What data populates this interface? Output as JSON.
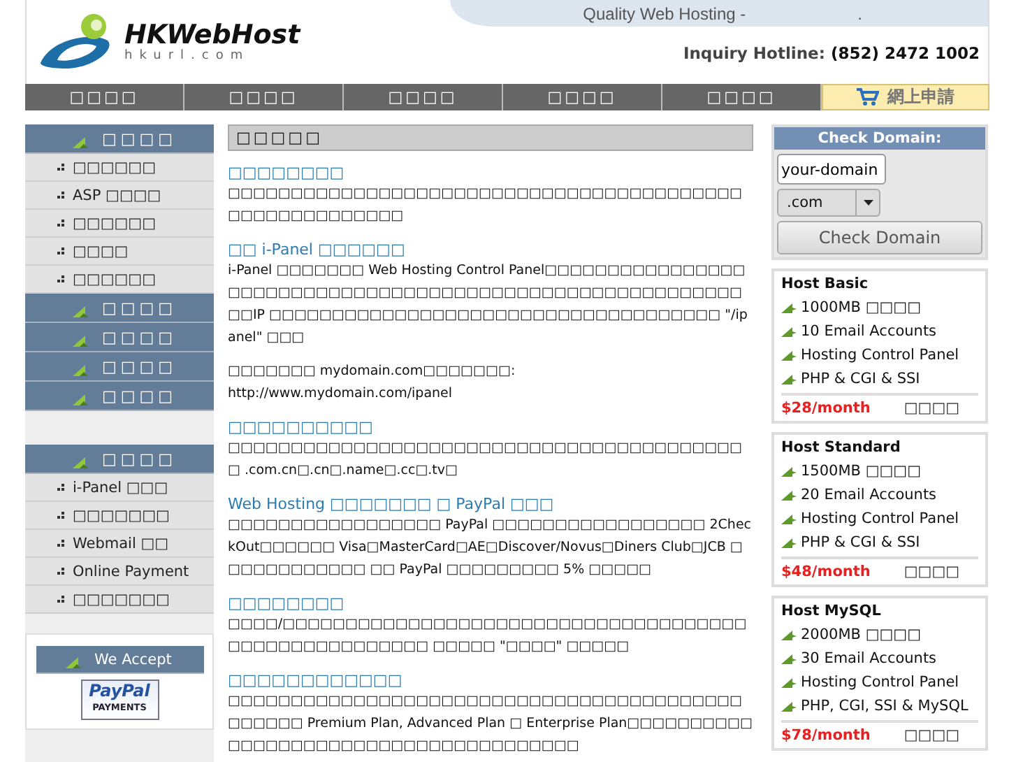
{
  "header": {
    "logo_name": "HKWebHost",
    "logo_url": "hkurl.com",
    "tagline": "Quality Web Hosting -",
    "tagline_suffix": ".",
    "hotline_label": "Inquiry Hotline:",
    "hotline_number": "(852) 2472 1002"
  },
  "nav": {
    "items": [
      "□□□□",
      "□□□□",
      "□□□□",
      "□□□□",
      "□□□□"
    ],
    "order_button": "網上申請"
  },
  "sidebar": {
    "menu": [
      {
        "title": "□□□□",
        "children": [
          "□□□□□□",
          "ASP □□□□",
          "□□□□□□",
          "□□□□",
          "□□□□□□"
        ]
      },
      {
        "title": "□□□□"
      },
      {
        "title": "□□□□"
      },
      {
        "title": "□□□□"
      },
      {
        "title": "□□□□"
      }
    ],
    "support": {
      "title": "□□□□",
      "children": [
        "i-Panel □□□",
        "□□□□□□□",
        "Webmail □□",
        "Online Payment",
        "□□□□□□□"
      ]
    },
    "accept": {
      "title": "We Accept",
      "logo_top": "PayPal",
      "logo_bottom": "PAYMENTS"
    }
  },
  "content": {
    "title": "□□□□□",
    "sections": [
      {
        "heading": "□□□□□□□□",
        "paragraphs": [
          "□□□□□□□□□□□□□□□□□□□□□□□□□□□□□□□□□□□□□□□□□□□□□□□□□□□□□□□"
        ]
      },
      {
        "heading": "□□ i-Panel □□□□□□",
        "paragraphs": [
          "i-Panel □□□□□□□ Web Hosting Control Panel□□□□□□□□□□□□□□□□□□□□□□□□□□□□□□□□□□□□□□□□□□□□□□□□□□□□□□□□□□□IP □□□□□□□□□□□□□□□□□□□□□□□□□□□□□□□□□□□□ \"/ipanel\" □□□",
          "□□□□□□□ mydomain.com□□□□□□□:\nhttp://www.mydomain.com/ipanel"
        ]
      },
      {
        "heading": "□□□□□□□□□□",
        "paragraphs": [
          "□□□□□□□□□□□□□□□□□□□□□□□□□□□□□□□□□□□□□□□□□□ .com.cn□.cn□.name□.cc□.tv□"
        ]
      },
      {
        "heading": "Web Hosting □□□□□□□ □ PayPal □□□",
        "paragraphs": [
          "□□□□□□□□□□□□□□□□□ PayPal □□□□□□□□□□□□□□□□□ 2CheckOut□□□□□□ Visa□MasterCard□AE□Discover/Novus□Diners Club□JCB □□□□□□□□□□□□ □□ PayPal □□□□□□□□□ 5% □□□□□"
        ]
      },
      {
        "heading": "□□□□□□□□",
        "paragraphs": [
          "□□□□/□□□□□□□□□□□□□□□□□□□□□□□□□□□□□□□□□□□□□□□□□□□□□□□□□□□□□ □□□□□ \"□□□□\" □□□□□"
        ]
      },
      {
        "heading": "□□□□□□□□□□□□",
        "paragraphs": [
          "□□□□□□□□□□□□□□□□□□□□□□□□□□□□□□□□□□□□□□□□□□□□□□□ Premium Plan, Advanced Plan □ Enterprise Plan□□□□□□□□□□□□□□□□□□□□□□□□□□□□□□□□□□□□□□"
        ]
      }
    ]
  },
  "domain": {
    "title": "Check Domain:",
    "value": "your-domain",
    "extension": ".com",
    "button": "Check Domain"
  },
  "plans": [
    {
      "name": "Host Basic",
      "features": [
        "1000MB □□□□",
        "10 Email Accounts",
        "Hosting Control Panel",
        "PHP & CGI & SSI"
      ],
      "price": "$28/month",
      "action": "□□□□"
    },
    {
      "name": "Host Standard",
      "features": [
        "1500MB □□□□",
        "20 Email Accounts",
        "Hosting Control Panel",
        "PHP & CGI & SSI"
      ],
      "price": "$48/month",
      "action": "□□□□"
    },
    {
      "name": "Host MySQL",
      "features": [
        "2000MB □□□□",
        "30 Email Accounts",
        "Hosting Control Panel",
        "PHP, CGI, SSI & MySQL"
      ],
      "price": "$78/month",
      "action": "□□□□"
    }
  ]
}
